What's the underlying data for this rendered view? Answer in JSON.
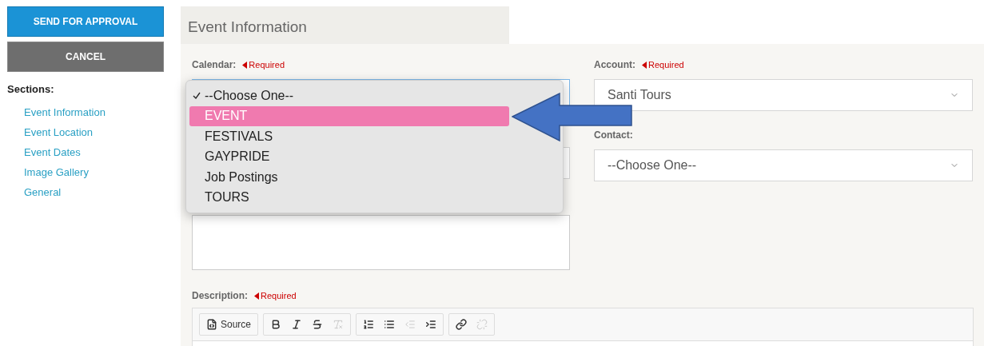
{
  "sidebar": {
    "buttons": [
      {
        "label": "SEND FOR APPROVAL",
        "kind": "primary"
      },
      {
        "label": "CANCEL",
        "kind": "secondary"
      }
    ],
    "sections_title": "Sections:",
    "links": [
      "Event Information",
      "Event Location",
      "Event Dates",
      "Image Gallery",
      "General"
    ]
  },
  "panel": {
    "title": "Event Information"
  },
  "calendar": {
    "label": "Calendar:",
    "required": "Required",
    "options": [
      {
        "label": "--Choose One--",
        "checked": true,
        "highlighted": false
      },
      {
        "label": "EVENT",
        "checked": false,
        "highlighted": true
      },
      {
        "label": "FESTIVALS",
        "checked": false,
        "highlighted": false
      },
      {
        "label": "GAYPRIDE",
        "checked": false,
        "highlighted": false
      },
      {
        "label": "Job Postings",
        "checked": false,
        "highlighted": false
      },
      {
        "label": "TOURS",
        "checked": false,
        "highlighted": false
      }
    ]
  },
  "account": {
    "label": "Account:",
    "required": "Required",
    "value": "Santi Tours"
  },
  "contact": {
    "label": "Contact:",
    "value": "--Choose One--"
  },
  "description": {
    "label": "Description:",
    "required": "Required",
    "toolbar": [
      [
        {
          "kind": "source",
          "label": "Source",
          "disabled": false
        }
      ],
      [
        {
          "kind": "bold",
          "disabled": false
        },
        {
          "kind": "italic",
          "disabled": false
        },
        {
          "kind": "strike",
          "disabled": false
        },
        {
          "kind": "clear",
          "disabled": true
        }
      ],
      [
        {
          "kind": "numbered",
          "disabled": false
        },
        {
          "kind": "bulleted",
          "disabled": false
        },
        {
          "kind": "outdent",
          "disabled": true
        },
        {
          "kind": "indent",
          "disabled": false
        }
      ],
      [
        {
          "kind": "link",
          "disabled": false
        },
        {
          "kind": "unlink",
          "disabled": true
        }
      ]
    ]
  }
}
